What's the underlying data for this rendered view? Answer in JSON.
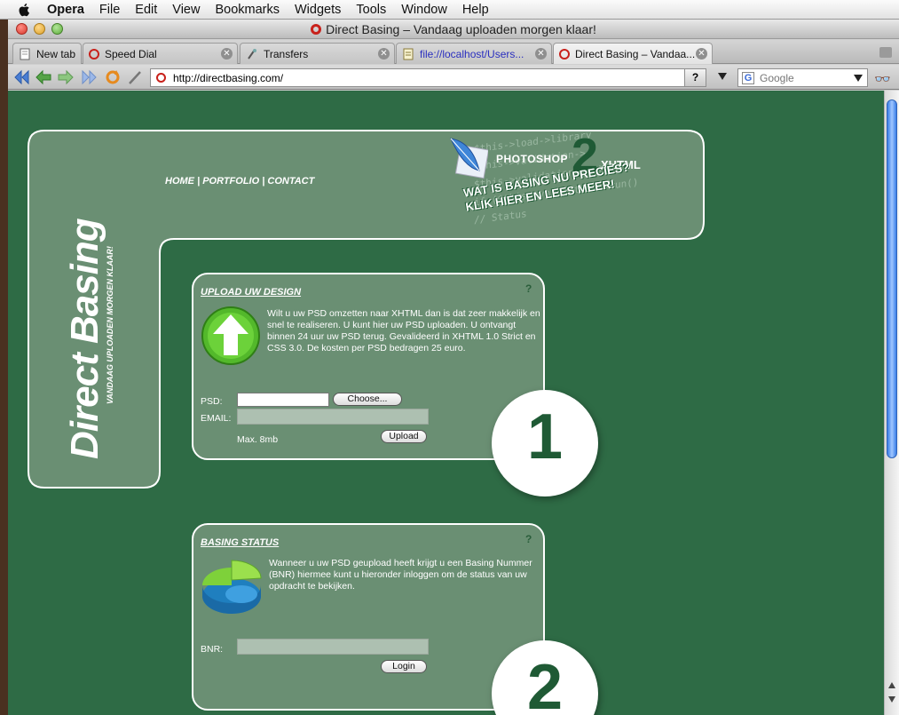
{
  "menubar": {
    "app_name": "Opera",
    "items": [
      "File",
      "Edit",
      "View",
      "Bookmarks",
      "Widgets",
      "Tools",
      "Window",
      "Help"
    ]
  },
  "window": {
    "title": "Direct Basing – Vandaag uploaden morgen klaar!"
  },
  "tabs": [
    {
      "label": "New tab",
      "icon": "page-icon"
    },
    {
      "label": "Speed Dial",
      "icon": "opera-icon"
    },
    {
      "label": "Transfers",
      "icon": "transfers-icon"
    },
    {
      "label": "file://localhost/Users...",
      "icon": "document-icon"
    },
    {
      "label": "Direct Basing – Vandaa...",
      "icon": "opera-icon",
      "active": true
    }
  ],
  "addressbar": {
    "url": "http://directbasing.com/",
    "help": "?",
    "search_placeholder": "Google"
  },
  "site": {
    "logo": "Direct Basing",
    "tagline": "VANDAAG UPLOADEN MORGEN KLAAR!",
    "nav": [
      "HOME",
      "PORTFOLIO",
      "CONTACT"
    ],
    "nav_sep": "|",
    "banner": {
      "line1_a": "PHOTOSHOP",
      "line1_num": "2",
      "line1_b": "XHTML",
      "line2": "WAT IS BASING NU PRECIES?",
      "line3": "KLIK HIER EN LEES MEER!",
      "code": "$this->load->library\n$this->validation->\n$this->validation->set_ru\nif ($this->validation->run()\n// Status"
    },
    "upload": {
      "title": "UPLOAD UW DESIGN",
      "help": "?",
      "text": "Wilt u uw PSD omzetten naar XHTML dan is dat zeer makkelijk en snel te realiseren. U kunt hier uw PSD uploaden. U ontvangt binnen 24 uur uw PSD terug. Gevalideerd in XHTML 1.0 Strict en CSS 3.0. De kosten per PSD bedragen 25 euro.",
      "psd_label": "PSD:",
      "choose_label": "Choose...",
      "email_label": "EMAIL:",
      "max_label": "Max. 8mb",
      "submit_label": "Upload",
      "step": "1"
    },
    "status": {
      "title": "BASING STATUS",
      "help": "?",
      "text": "Wanneer u uw PSD geupload heeft krijgt u een Basing Nummer (BNR) hiermee kunt u hieronder inloggen om de status van uw opdracht te bekijken.",
      "bnr_label": "BNR:",
      "submit_label": "Login",
      "step": "2"
    }
  },
  "colors": {
    "page_bg": "#2e6b45",
    "panel_bg": "#6a8f73",
    "accent_dark": "#1f5a35",
    "scroll_thumb": "#3a7ee8"
  }
}
